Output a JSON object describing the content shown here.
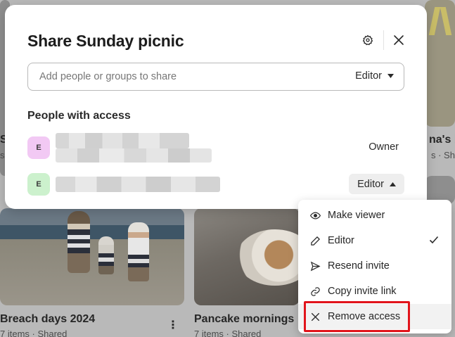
{
  "background": {
    "albums": [
      {
        "title": "Breach days 2024",
        "subtitle": "7 items · Shared"
      },
      {
        "title": "Pancake mornings",
        "subtitle": "7 items · Shared"
      },
      {
        "title": "na's b",
        "subtitle": "s · Shar"
      },
      {
        "title": "S",
        "subtitle": "s"
      }
    ],
    "more_icon": "⋮"
  },
  "dialog": {
    "title": "Share Sunday picnic",
    "input_placeholder": "Add people or groups to share",
    "default_role": "Editor",
    "section_title": "People with access",
    "people": [
      {
        "initial": "E",
        "role": "Owner",
        "avatar_color": "#f2c9f4"
      },
      {
        "initial": "E",
        "role": "Editor",
        "avatar_color": "#ccf1cd"
      }
    ]
  },
  "menu": {
    "items": [
      {
        "label": "Make viewer",
        "icon": "eye-icon"
      },
      {
        "label": "Editor",
        "icon": "pencil-icon",
        "checked": true
      },
      {
        "label": "Resend invite",
        "icon": "send-icon"
      },
      {
        "label": "Copy invite link",
        "icon": "link-icon"
      },
      {
        "label": "Remove access",
        "icon": "close-icon",
        "highlighted": true
      }
    ]
  },
  "colors": {
    "highlight": "#e1141b",
    "dialog_bg": "#ffffff"
  }
}
